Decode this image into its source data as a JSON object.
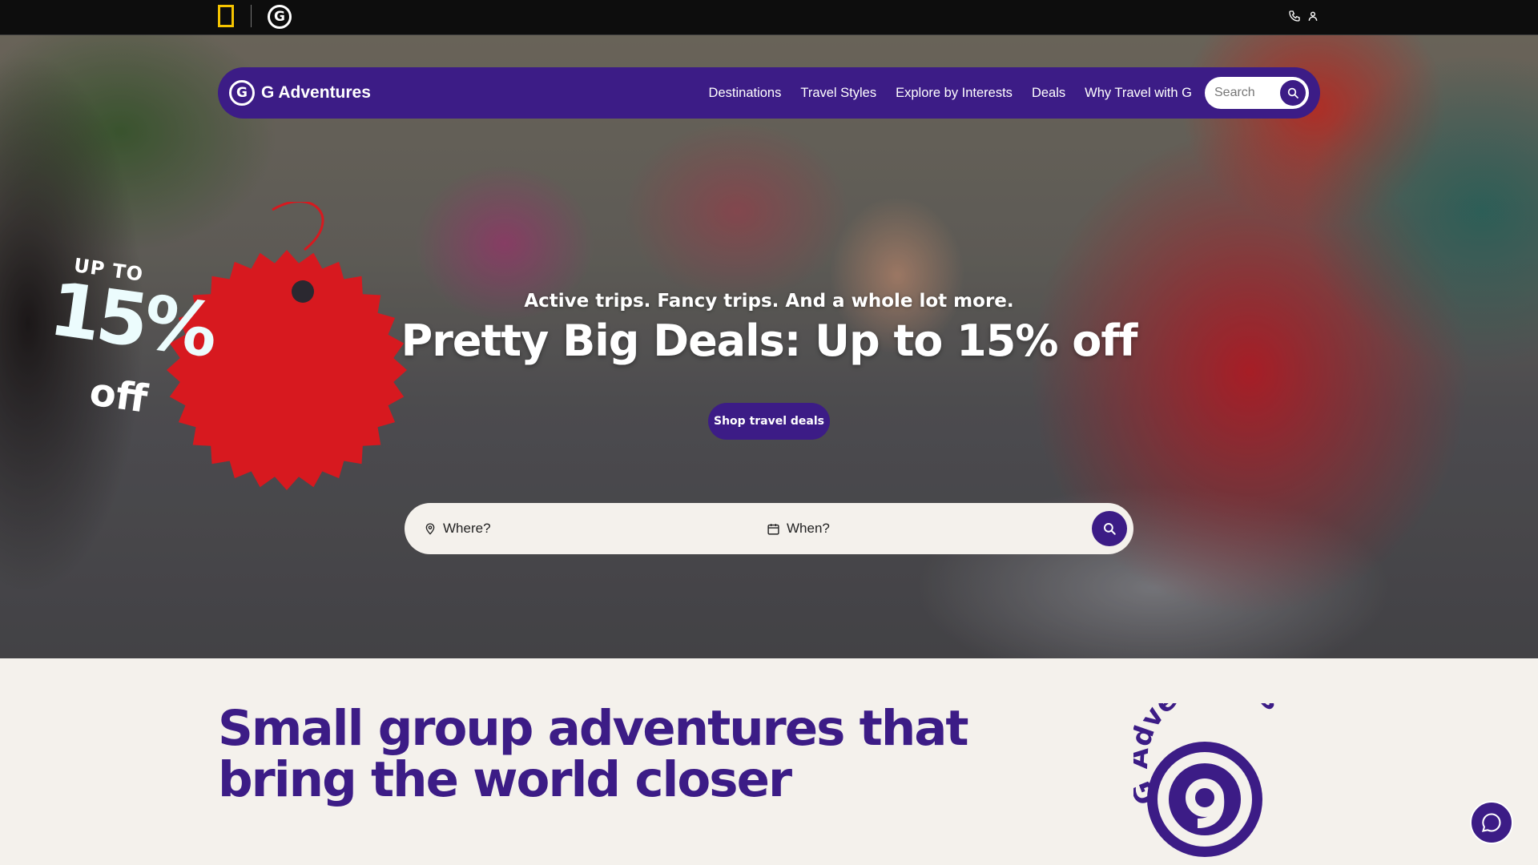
{
  "topbar": {
    "ng_logo": "national-geographic-logo",
    "g_logo_char": "G",
    "icons": [
      "phone-icon",
      "user-icon"
    ]
  },
  "nav": {
    "brand": "G Adventures",
    "brand_char": "G",
    "links": [
      "Destinations",
      "Travel Styles",
      "Explore by Interests",
      "Deals",
      "Why Travel with G"
    ],
    "search_placeholder": "Search"
  },
  "badge": {
    "up_to": "UP TO",
    "percent": "15%",
    "off": "off"
  },
  "hero": {
    "subtitle": "Active trips. Fancy trips. And a whole lot more.",
    "title": "Pretty Big Deals: Up to 15% off",
    "cta": "Shop travel deals"
  },
  "trip_finder": {
    "where": "Where?",
    "when": "When?"
  },
  "section": {
    "title_line1": "Small group adventures that",
    "title_line2": "bring the world closer"
  },
  "round_logo": {
    "ring_text": "G Adventures"
  },
  "colors": {
    "brand_purple": "#3c1c86",
    "badge_red": "#d7191f",
    "ng_yellow": "#f5c400",
    "page_bg": "#f4f1ec"
  }
}
